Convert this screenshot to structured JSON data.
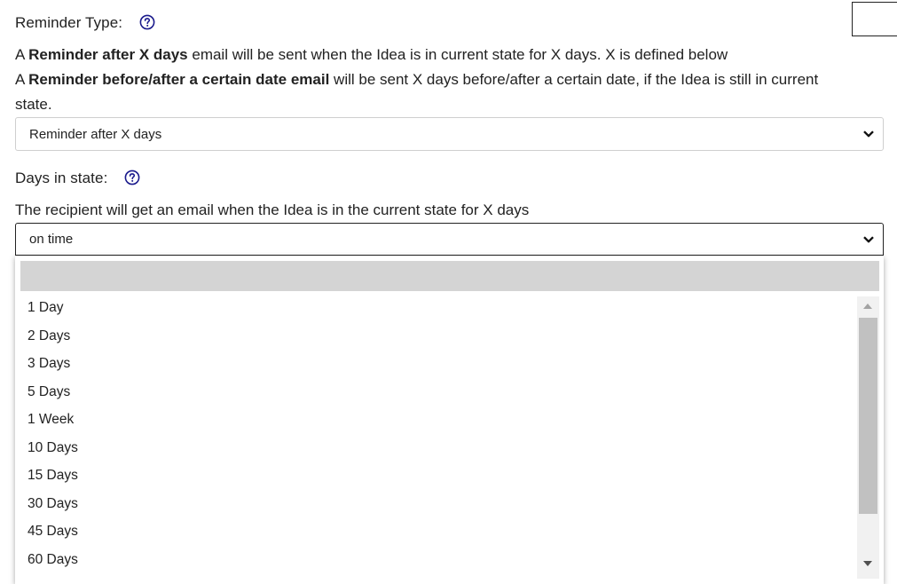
{
  "reminder_type": {
    "label": "Reminder Type:",
    "line1_prefix": "A ",
    "line1_bold": "Reminder after X days",
    "line1_rest": " email will be sent when the Idea is in current state for X days. X is defined below",
    "line2_prefix": "A ",
    "line2_bold": "Reminder before/after a certain date email",
    "line2_rest": " will be sent X days before/after a certain date, if the Idea is still in current",
    "line2_cont": "state.",
    "selected": "Reminder after X days"
  },
  "days_in_state": {
    "label": "Days in state:",
    "description": "The recipient will get an email when the Idea is in the current state for X days",
    "selected": "on time",
    "options": [
      "1 Day",
      "2 Days",
      "3 Days",
      "5 Days",
      "1 Week",
      "10 Days",
      "15 Days",
      "30 Days",
      "45 Days",
      "60 Days"
    ]
  },
  "colors": {
    "text": "#222222",
    "help_icon": "#1a1a8c",
    "highlight_option": "#d4d4d4",
    "border": "#cfcfcf"
  },
  "icons": {
    "help": "question-circle-icon",
    "chevron": "chevron-down-icon"
  }
}
